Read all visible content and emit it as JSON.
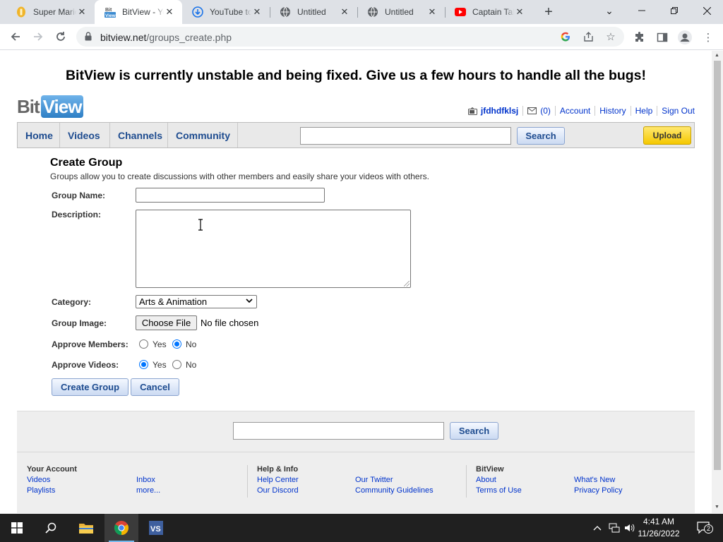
{
  "browser": {
    "tabs": [
      {
        "title": "Super Mario",
        "favicon": "coin-icon"
      },
      {
        "title": "BitView - Your",
        "favicon": "bitview-icon",
        "active": true
      },
      {
        "title": "YouTube to",
        "favicon": "download-icon"
      },
      {
        "title": "Untitled",
        "favicon": "globe-icon"
      },
      {
        "title": "Untitled",
        "favicon": "globe-icon"
      },
      {
        "title": "Captain Tal",
        "favicon": "youtube-icon"
      }
    ],
    "url_host": "bitview.net",
    "url_path": "/groups_create.php"
  },
  "page": {
    "banner": "BitView is currently unstable and being fixed. Give us a few hours to handle all the bugs!",
    "logo": {
      "part1": "Bit",
      "part2": "View"
    },
    "userbar": {
      "username": "jfdhdfklsj",
      "inbox_count": "(0)",
      "account": "Account",
      "history": "History",
      "help": "Help",
      "sign_out": "Sign Out"
    },
    "nav": {
      "home": "Home",
      "videos": "Videos",
      "channels": "Channels",
      "community": "Community",
      "search_button": "Search",
      "upload_button": "Upload"
    },
    "form": {
      "title": "Create Group",
      "subtitle": "Groups allow you to create discussions with other members and easily share your videos with others.",
      "group_name_label": "Group Name:",
      "group_name_value": "",
      "description_label": "Description:",
      "description_value": "",
      "category_label": "Category:",
      "category_value": "Arts & Animation",
      "group_image_label": "Group Image:",
      "choose_file": "Choose File",
      "no_file": "No file chosen",
      "approve_members_label": "Approve Members:",
      "approve_videos_label": "Approve Videos:",
      "yes": "Yes",
      "no": "No",
      "approve_members": "No",
      "approve_videos": "Yes",
      "create_button": "Create Group",
      "cancel_button": "Cancel"
    },
    "footer": {
      "search_button": "Search",
      "col1": {
        "heading": "Your Account",
        "links": [
          "Videos",
          "Playlists",
          "Inbox",
          "more..."
        ]
      },
      "col2": {
        "heading": "Help & Info",
        "links": [
          "Help Center",
          "Our Discord",
          "Our Twitter",
          "Community Guidelines"
        ]
      },
      "col3": {
        "heading": "BitView",
        "links": [
          "About",
          "Terms of Use",
          "What's New",
          "Privacy Policy"
        ]
      }
    }
  },
  "taskbar": {
    "time": "4:41 AM",
    "date": "11/26/2022",
    "notification_count": "2"
  }
}
